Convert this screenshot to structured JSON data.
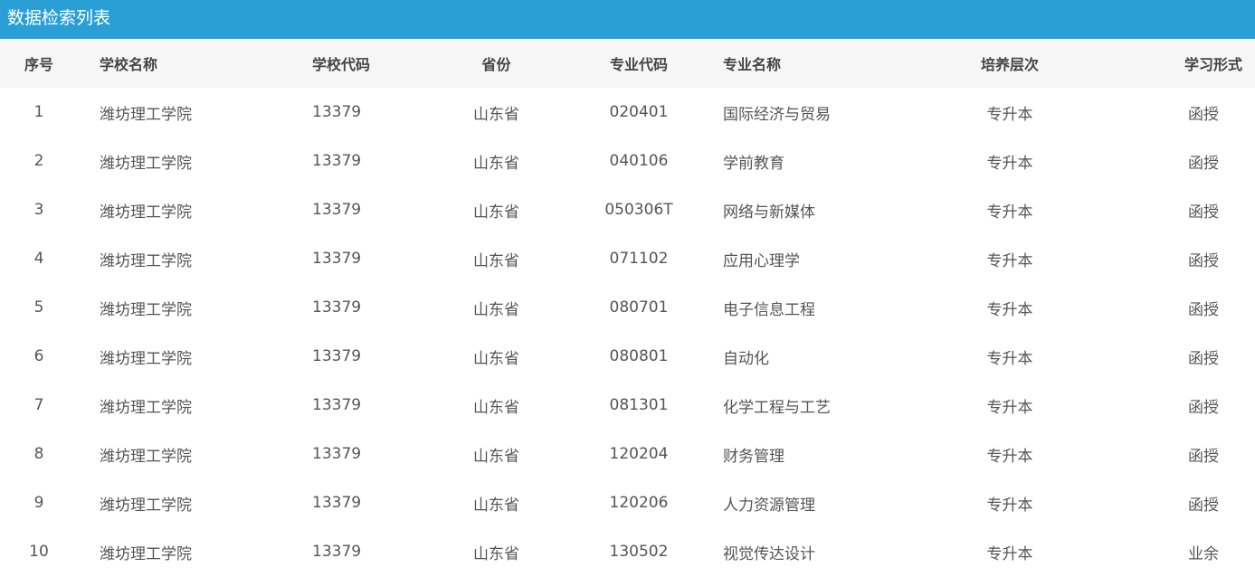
{
  "page": {
    "title": "数据检索列表",
    "header_color": "#2a9fd6"
  },
  "table": {
    "columns": [
      "序号",
      "学校名称",
      "学校代码",
      "省份",
      "专业代码",
      "专业名称",
      "培养层次",
      "学习形式"
    ],
    "rows": [
      [
        "1",
        "潍坊理工学院",
        "13379",
        "山东省",
        "020401",
        "国际经济与贸易",
        "专升本",
        "函授"
      ],
      [
        "2",
        "潍坊理工学院",
        "13379",
        "山东省",
        "040106",
        "学前教育",
        "专升本",
        "函授"
      ],
      [
        "3",
        "潍坊理工学院",
        "13379",
        "山东省",
        "050306T",
        "网络与新媒体",
        "专升本",
        "函授"
      ],
      [
        "4",
        "潍坊理工学院",
        "13379",
        "山东省",
        "071102",
        "应用心理学",
        "专升本",
        "函授"
      ],
      [
        "5",
        "潍坊理工学院",
        "13379",
        "山东省",
        "080701",
        "电子信息工程",
        "专升本",
        "函授"
      ],
      [
        "6",
        "潍坊理工学院",
        "13379",
        "山东省",
        "080801",
        "自动化",
        "专升本",
        "函授"
      ],
      [
        "7",
        "潍坊理工学院",
        "13379",
        "山东省",
        "081301",
        "化学工程与工艺",
        "专升本",
        "函授"
      ],
      [
        "8",
        "潍坊理工学院",
        "13379",
        "山东省",
        "120204",
        "财务管理",
        "专升本",
        "函授"
      ],
      [
        "9",
        "潍坊理工学院",
        "13379",
        "山东省",
        "120206",
        "人力资源管理",
        "专升本",
        "函授"
      ],
      [
        "10",
        "潍坊理工学院",
        "13379",
        "山东省",
        "130502",
        "视觉传达设计",
        "专升本",
        "业余"
      ]
    ]
  }
}
